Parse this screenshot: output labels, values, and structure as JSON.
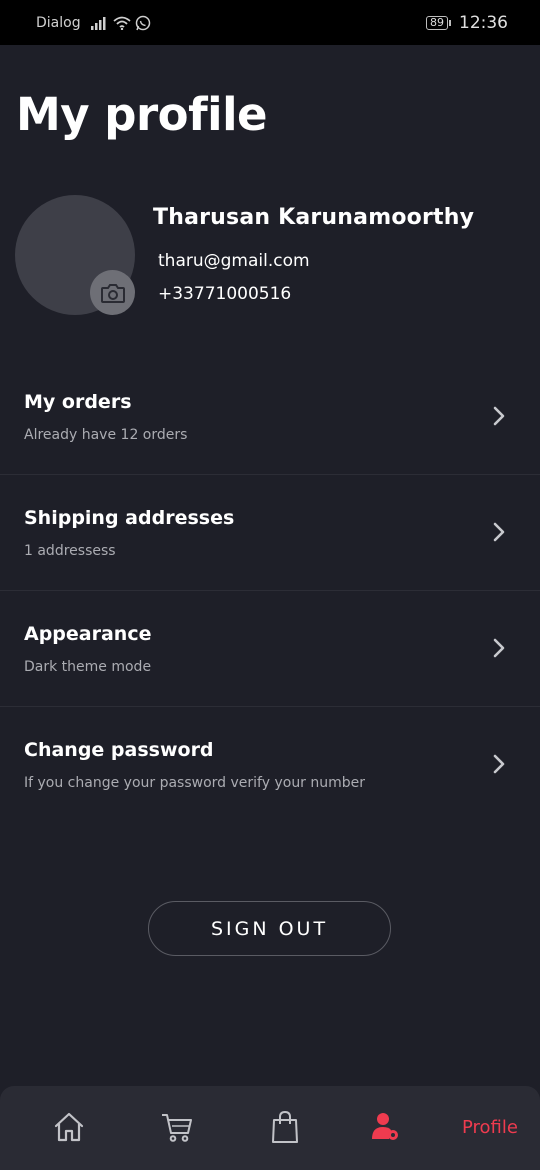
{
  "status_bar": {
    "carrier": "Dialog",
    "battery": "89",
    "time": "12:36"
  },
  "page": {
    "title": "My profile"
  },
  "profile": {
    "name": "Tharusan Karunamoorthy",
    "email": "tharu@gmail.com",
    "phone": "+33771000516"
  },
  "menu": [
    {
      "title": "My orders",
      "subtitle": "Already have 12 orders"
    },
    {
      "title": "Shipping addresses",
      "subtitle": "1 addressess"
    },
    {
      "title": "Appearance",
      "subtitle": "Dark theme mode"
    },
    {
      "title": "Change password",
      "subtitle": "If you change your password verify your number"
    }
  ],
  "actions": {
    "sign_out_label": "SIGN OUT"
  },
  "bottom_nav": {
    "items": [
      {
        "icon": "home-icon",
        "label": ""
      },
      {
        "icon": "cart-icon",
        "label": ""
      },
      {
        "icon": "bag-icon",
        "label": ""
      },
      {
        "icon": "user-settings-icon",
        "label": "Profile"
      }
    ],
    "active_color": "#ef3b4f"
  },
  "colors": {
    "background": "#1e1f28",
    "accent": "#ef3b4f"
  }
}
